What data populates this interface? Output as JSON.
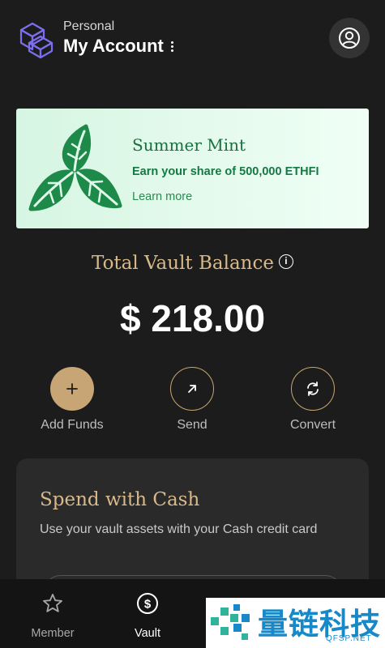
{
  "header": {
    "account_kind": "Personal",
    "account_name": "My Account",
    "logo_icon": "ether-fi-logo-icon",
    "menu_icon": "kebab-menu-icon",
    "profile_icon": "user-circle-icon"
  },
  "promo": {
    "title": "Summer Mint",
    "subtitle": "Earn your share of 500,000 ETHFI",
    "link": "Learn more",
    "icon": "leaf-icon"
  },
  "balance": {
    "label": "Total Vault Balance",
    "info_icon": "info-icon",
    "value": "$ 218.00"
  },
  "actions": [
    {
      "label": "Add Funds",
      "icon": "plus-icon"
    },
    {
      "label": "Send",
      "icon": "arrow-up-right-icon"
    },
    {
      "label": "Convert",
      "icon": "convert-icon"
    }
  ],
  "cash": {
    "title": "Spend with Cash",
    "description": "Use your vault assets with your Cash credit card"
  },
  "nav": [
    {
      "label": "Member",
      "icon": "star-icon",
      "active": false
    },
    {
      "label": "Vault",
      "icon": "dollar-circle-icon",
      "active": true
    }
  ],
  "watermark": {
    "text": "量链科技",
    "sub": "QFSP.NET"
  },
  "colors": {
    "background": "#1c1c1c",
    "accent_gold": "#c8a574",
    "promo_green": "#147a44",
    "promo_bg": "#e0f9ea"
  }
}
